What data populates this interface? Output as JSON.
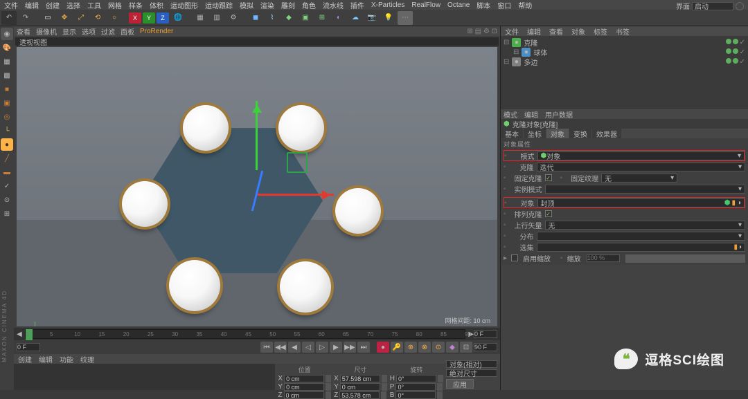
{
  "top_dropdown": {
    "label": "界面",
    "value": "启动"
  },
  "menu": [
    "文件",
    "编辑",
    "创建",
    "选择",
    "工具",
    "网格",
    "样条",
    "体积",
    "运动图形",
    "运动跟踪",
    "模拟",
    "渲染",
    "雕刻",
    "角色",
    "流水线",
    "插件",
    "X-Particles",
    "RealFlow",
    "Octane",
    "脚本",
    "窗口",
    "帮助"
  ],
  "subbar": {
    "items": [
      "查看",
      "摄像机",
      "显示",
      "选项",
      "过滤",
      "面板"
    ],
    "active": "ProRender"
  },
  "viewport": {
    "title": "透视视图",
    "footer": "网格间距: 10 cm"
  },
  "timeline": {
    "start": 0,
    "end": 90,
    "fps_field": "0 F"
  },
  "bottom_tabs": [
    "创建",
    "编辑",
    "功能",
    "纹理"
  ],
  "coords": {
    "pos": {
      "label": "位置",
      "x": "0 cm",
      "y": "0 cm",
      "z": "0 cm"
    },
    "size": {
      "label": "尺寸",
      "x": "57.598 cm",
      "y": "0 cm",
      "z": "53.578 cm"
    },
    "rot": {
      "label": "旋转",
      "h": "0°",
      "p": "0°",
      "b": "0°"
    },
    "mode": "对象(相对)",
    "sizemode": "绝对尺寸",
    "apply": "应用"
  },
  "r_tabs_top": [
    "文件",
    "编辑",
    "查看",
    "对象",
    "标签",
    "书签"
  ],
  "hierarchy": [
    {
      "name": "克隆",
      "color": "#4ab04a",
      "muted": false
    },
    {
      "name": "球体",
      "color": "#4a90c7",
      "indent": 1
    },
    {
      "name": "多边",
      "color": "#808080",
      "indent": 0
    }
  ],
  "attr_tabs_top": [
    "模式",
    "编辑",
    "用户数据"
  ],
  "attr_title": "克隆对象[克隆]",
  "attr_tabs": [
    "基本",
    "坐标",
    "对象",
    "变换",
    "效果器"
  ],
  "attr_active": "对象",
  "attr": {
    "section": "对象属性",
    "mode": {
      "label": "模式",
      "value": "对象"
    },
    "clone": {
      "label": "克隆",
      "value": "迭代"
    },
    "fixclone": {
      "label": "固定克隆",
      "checked": true
    },
    "fixtex": {
      "label": "固定纹理",
      "value": "无"
    },
    "inst": {
      "label": "实例模式",
      "value": ""
    },
    "obj": {
      "label": "对象",
      "value": "封顶"
    },
    "align": {
      "label": "排列克隆",
      "checked": true
    },
    "up": {
      "label": "上行矢量",
      "value": "无"
    },
    "dist": {
      "label": "分布",
      "value": ""
    },
    "sel": {
      "label": "选集",
      "value": ""
    },
    "enable": {
      "label": "启用缩放",
      "checked": false
    },
    "scale": {
      "label": "缩放",
      "value": "100 %"
    }
  },
  "watermark": "逗格SCI绘图",
  "brand": "MAXON CINEMA 4D"
}
